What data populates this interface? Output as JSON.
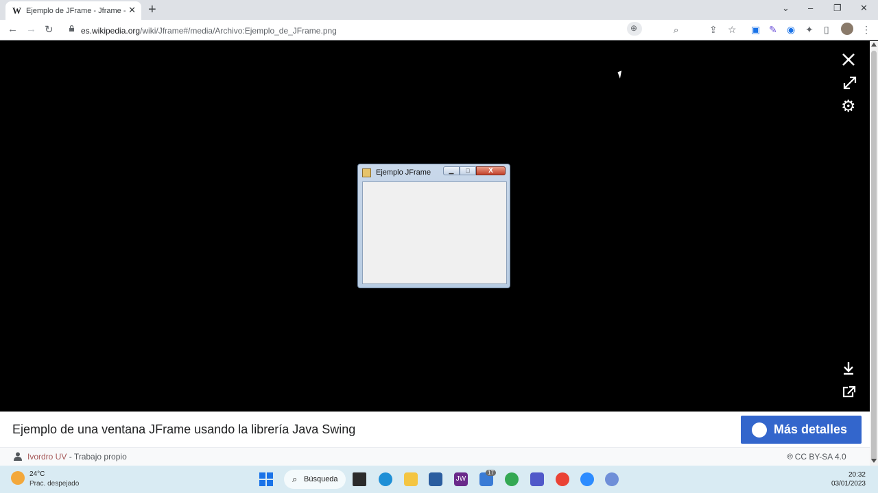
{
  "browser": {
    "tab_title": "Ejemplo de JFrame - Jframe - Wi",
    "tab_favicon": "W",
    "url_domain": "es.wikipedia.org",
    "url_path": "/wiki/Jframe#/media/Archivo:Ejemplo_de_JFrame.png"
  },
  "jframe": {
    "title": "Ejemplo JFrame"
  },
  "caption": {
    "text": "Ejemplo de una ventana JFrame usando la librería Java Swing",
    "details_button": "Más detalles",
    "author": "Ivordro UV",
    "author_separator": " - ",
    "work_type": "Trabajo propio",
    "license": "CC BY-SA 4.0"
  },
  "taskbar": {
    "temperature": "24°C",
    "weather": "Prac. despejado",
    "search_label": "Búsqueda",
    "mail_badge": "17",
    "time": "20:32",
    "date": "03/01/2023"
  },
  "icons": {
    "close": "close-icon",
    "expand": "expand-icon",
    "settings": "gear-icon",
    "download": "download-icon",
    "share": "share-icon"
  },
  "colors": {
    "viewer_bg": "#000000",
    "details_button": "#3366cc",
    "author_link": "#a55858",
    "taskbar": "#d9ebf3"
  }
}
